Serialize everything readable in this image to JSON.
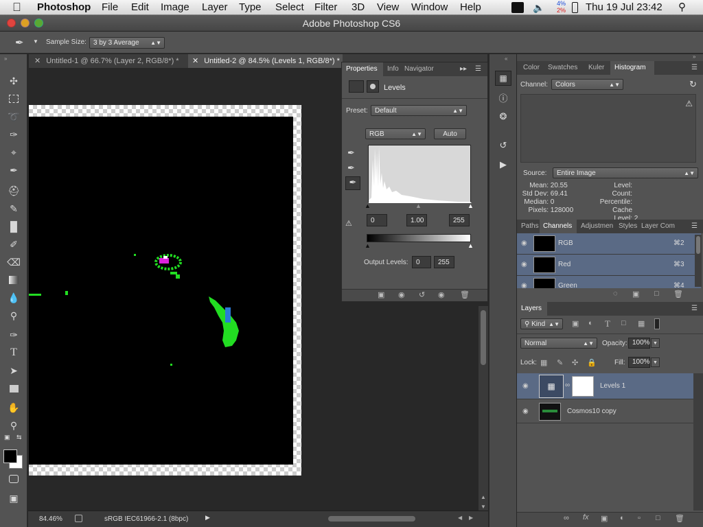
{
  "menubar": {
    "app": "Photoshop",
    "items": [
      "File",
      "Edit",
      "Image",
      "Layer",
      "Type",
      "Select",
      "Filter",
      "3D",
      "View",
      "Window",
      "Help"
    ],
    "battery_top": "4%",
    "battery_bottom": "2%",
    "clock": "Thu 19 Jul  23:42"
  },
  "window": {
    "title": "Adobe Photoshop CS6"
  },
  "options": {
    "sample_size_label": "Sample Size:",
    "sample_size_value": "3 by 3 Average"
  },
  "tabs": [
    {
      "label": "Untitled-1 @ 66.7% (Layer 2, RGB/8*) *"
    },
    {
      "label": "Untitled-2 @ 84.5% (Levels 1, RGB/8*) *"
    }
  ],
  "status": {
    "zoom": "84.46%",
    "profile": "sRGB IEC61966-2.1 (8bpc)"
  },
  "properties": {
    "tabs": [
      "Properties",
      "Info",
      "Navigator"
    ],
    "title": "Levels",
    "preset_label": "Preset:",
    "preset_value": "Default",
    "channel": "RGB",
    "auto_label": "Auto",
    "input_black": "0",
    "input_gamma": "1.00",
    "input_white": "255",
    "output_label": "Output Levels:",
    "output_black": "0",
    "output_white": "255"
  },
  "histogram": {
    "tabs": [
      "Color",
      "Swatches",
      "Kuler",
      "Histogram"
    ],
    "channel_label": "Channel:",
    "channel_value": "Colors",
    "source_label": "Source:",
    "source_value": "Entire Image",
    "stats_left": [
      {
        "k": "Mean:",
        "v": "20.55"
      },
      {
        "k": "Std Dev:",
        "v": "69.41"
      },
      {
        "k": "Median:",
        "v": "0"
      },
      {
        "k": "Pixels:",
        "v": "128000"
      }
    ],
    "stats_right": [
      {
        "k": "Level:",
        "v": ""
      },
      {
        "k": "Count:",
        "v": ""
      },
      {
        "k": "Percentile:",
        "v": ""
      },
      {
        "k": "Cache Level:",
        "v": "2"
      }
    ]
  },
  "channels": {
    "tabs": [
      "Paths",
      "Channels",
      "Adjustmen",
      "Styles",
      "Layer Com"
    ],
    "rows": [
      {
        "name": "RGB",
        "shortcut": "⌘2"
      },
      {
        "name": "Red",
        "shortcut": "⌘3"
      },
      {
        "name": "Green",
        "shortcut": "⌘4"
      }
    ]
  },
  "layers": {
    "tab": "Layers",
    "kind_label": "Kind",
    "blend_mode": "Normal",
    "opacity_label": "Opacity:",
    "opacity_value": "100%",
    "lock_label": "Lock:",
    "fill_label": "Fill:",
    "fill_value": "100%",
    "rows": [
      {
        "name": "Levels 1"
      },
      {
        "name": "Cosmos10 copy"
      }
    ]
  },
  "colors": {
    "menubar_bg": "#e4e4e4",
    "panel_bg": "#535353",
    "selected_row": "#5a6a85",
    "accent_green": "#22dd22"
  }
}
